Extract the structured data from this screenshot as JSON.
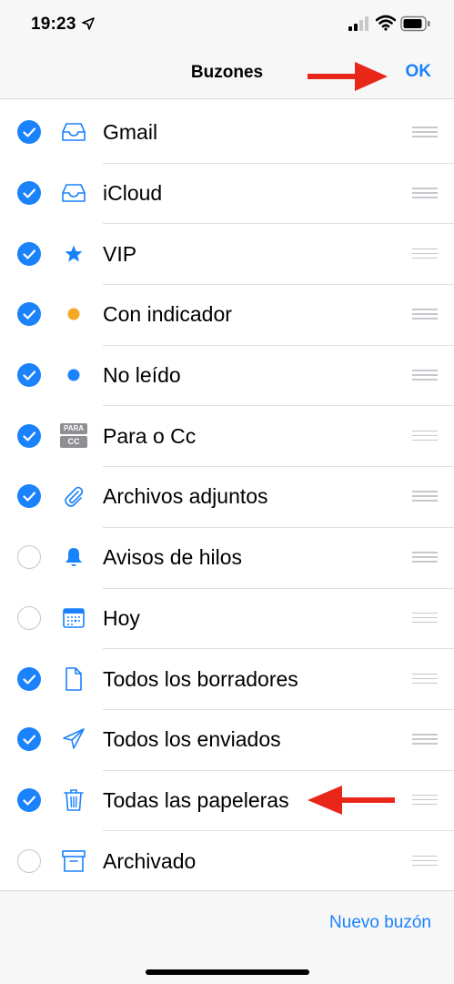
{
  "status": {
    "time": "19:23"
  },
  "nav": {
    "title": "Buzones",
    "ok_label": "OK"
  },
  "mailboxes": [
    {
      "label": "Gmail",
      "checked": true,
      "icon": "inbox-tray-icon"
    },
    {
      "label": "iCloud",
      "checked": true,
      "icon": "inbox-tray-icon"
    },
    {
      "label": "VIP",
      "checked": true,
      "icon": "star-icon"
    },
    {
      "label": "Con indicador",
      "checked": true,
      "icon": "orange-dot-icon"
    },
    {
      "label": "No leído",
      "checked": true,
      "icon": "blue-dot-icon"
    },
    {
      "label": "Para o Cc",
      "checked": true,
      "icon": "para-cc-icon",
      "icon_text_top": "PARA",
      "icon_text_bottom": "CC"
    },
    {
      "label": "Archivos adjuntos",
      "checked": true,
      "icon": "paperclip-icon"
    },
    {
      "label": "Avisos de hilos",
      "checked": false,
      "icon": "bell-icon"
    },
    {
      "label": "Hoy",
      "checked": false,
      "icon": "calendar-icon"
    },
    {
      "label": "Todos los borradores",
      "checked": true,
      "icon": "document-icon"
    },
    {
      "label": "Todos los enviados",
      "checked": true,
      "icon": "paper-plane-icon"
    },
    {
      "label": "Todas las papeleras",
      "checked": true,
      "icon": "trash-icon"
    },
    {
      "label": "Archivado",
      "checked": false,
      "icon": "archive-box-icon"
    }
  ],
  "bottom": {
    "new_mailbox_label": "Nuevo buzón"
  },
  "colors": {
    "accent": "#1a82fb",
    "annotation_arrow": "#e8271a",
    "flag": "#f5a623"
  }
}
